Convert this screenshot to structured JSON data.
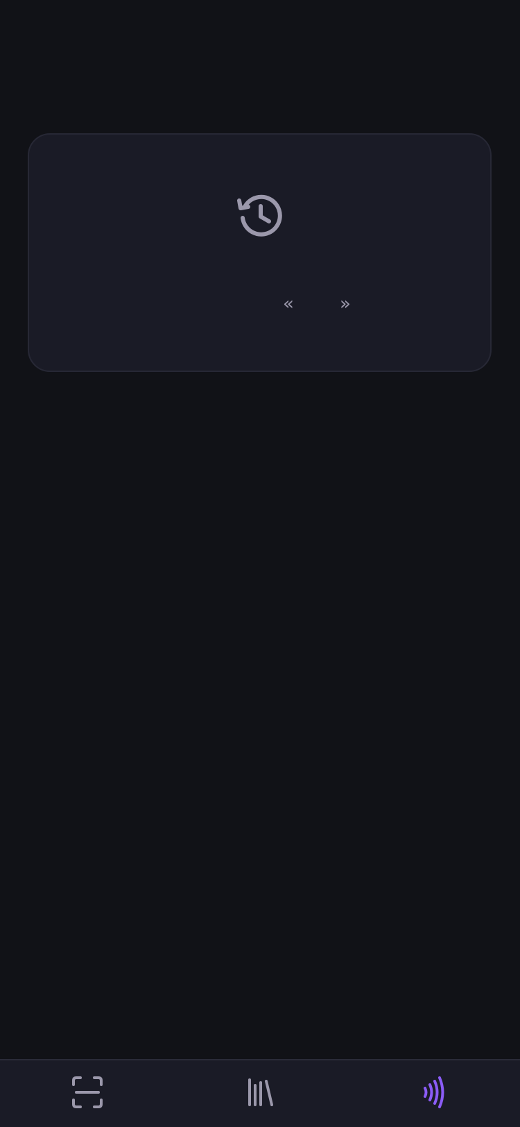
{
  "history_card": {
    "icon": "history-icon",
    "prev_label": "«",
    "next_label": "»"
  },
  "bottom_nav": {
    "tabs": [
      {
        "icon": "scan-icon",
        "active": false
      },
      {
        "icon": "library-icon",
        "active": false
      },
      {
        "icon": "nfc-icon",
        "active": true
      }
    ]
  },
  "colors": {
    "background": "#111217",
    "card": "#1a1b26",
    "icon_muted": "#9b98ab",
    "accent": "#8b5cf6"
  }
}
